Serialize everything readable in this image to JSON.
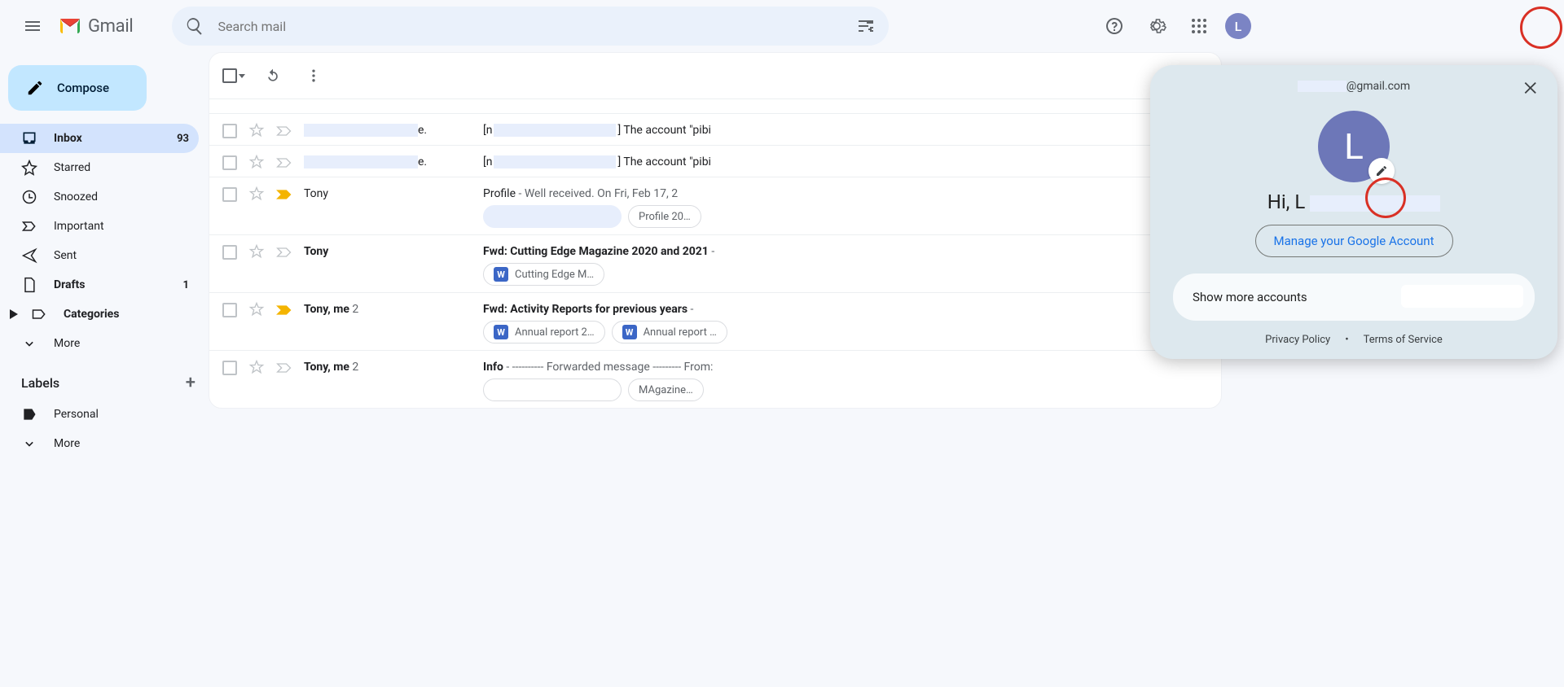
{
  "header": {
    "app_name": "Gmail",
    "search_placeholder": "Search mail",
    "avatar_letter": "L"
  },
  "sidebar": {
    "compose_label": "Compose",
    "items": [
      {
        "label": "Inbox",
        "count": "93"
      },
      {
        "label": "Starred"
      },
      {
        "label": "Snoozed"
      },
      {
        "label": "Important"
      },
      {
        "label": "Sent"
      },
      {
        "label": "Drafts",
        "count": "1"
      },
      {
        "label": "Categories"
      },
      {
        "label": "More"
      }
    ],
    "labels_header": "Labels",
    "labels": [
      {
        "label": "Personal"
      },
      {
        "label": "More"
      }
    ]
  },
  "rows": [
    {
      "unread": false,
      "sender_redacted": true,
      "sender_suffix": "e.",
      "subject_prefix": "[n",
      "subject_redacted": true,
      "subject_suffix": "] The account \"pibi",
      "important": false,
      "starred": false
    },
    {
      "unread": false,
      "sender_redacted": true,
      "sender_suffix": "e.",
      "subject_prefix": "[n",
      "subject_redacted": true,
      "subject_suffix": "] The account \"pibi",
      "important": false,
      "starred": false
    },
    {
      "unread": false,
      "sender": "Tony",
      "subject": "Profile",
      "preview": " - Well received. On Fri, Feb 17, 2",
      "important": true,
      "starred": false,
      "chips": [
        {
          "type": "redacted"
        },
        {
          "type": "plain",
          "label": "Profile 20…"
        }
      ]
    },
    {
      "unread": true,
      "sender": "Tony",
      "subject": "Fwd: Cutting Edge Magazine 2020 and 2021",
      "preview": " - ",
      "important": false,
      "starred": false,
      "chips": [
        {
          "type": "w",
          "label": "Cutting Edge M…"
        }
      ]
    },
    {
      "unread": true,
      "sender": "Tony, me",
      "sender_badge": "2",
      "subject": "Fwd: Activity Reports for previous years",
      "preview": " - ",
      "important": true,
      "starred": false,
      "chips": [
        {
          "type": "w",
          "label": "Annual report 2…"
        },
        {
          "type": "w",
          "label": "Annual report …"
        }
      ]
    },
    {
      "unread": true,
      "sender": "Tony, me",
      "sender_badge": "2",
      "subject": "Info",
      "preview": " - ---------- Forwarded message --------- From:",
      "important": false,
      "starred": false,
      "chips": [
        {
          "type": "plain",
          "label": ""
        },
        {
          "type": "plain",
          "label": "MAgazine…"
        }
      ]
    }
  ],
  "popover": {
    "email_suffix": "@gmail.com",
    "avatar_letter": "L",
    "greeting": "Hi, L",
    "manage_label": "Manage your Google Account",
    "more_accounts_label": "Show more accounts",
    "privacy_label": "Privacy Policy",
    "tos_label": "Terms of Service"
  }
}
